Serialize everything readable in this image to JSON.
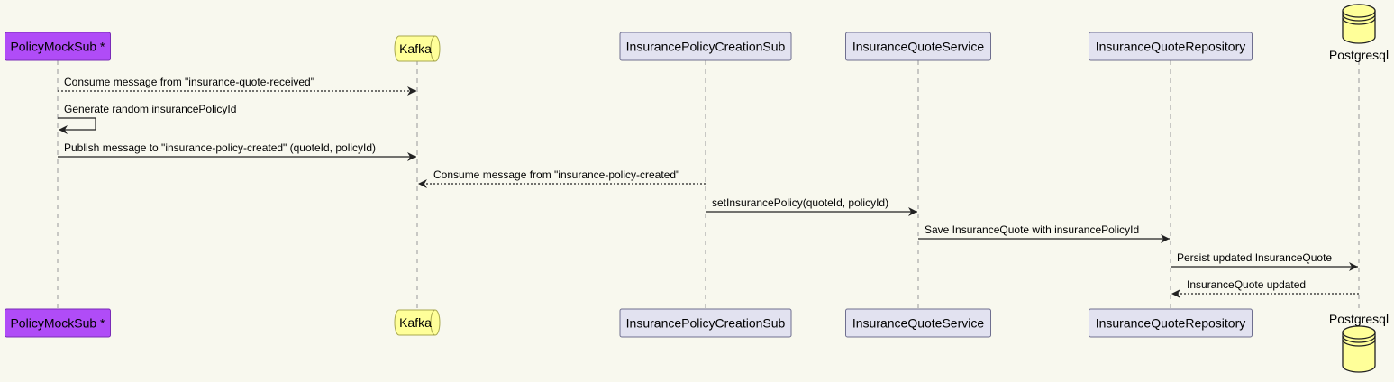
{
  "diagram": {
    "type": "sequence",
    "colors": {
      "background": "#f8f8ee",
      "highlight_fill": "#b04cf7",
      "highlight_stroke": "#7a2bb7",
      "queue_fill": "#ffff99",
      "queue_stroke": "#a8a84e",
      "participant_fill": "#e2e2f0",
      "participant_stroke": "#6f6f8f",
      "db_fill": "#ffff99",
      "db_stroke": "#222222",
      "lifeline": "#999999",
      "arrow": "#222222"
    },
    "participants": [
      {
        "id": "policymocksub",
        "label": "PolicyMockSub *",
        "shape": "rect",
        "style": "highlight"
      },
      {
        "id": "kafka",
        "label": "Kafka",
        "shape": "queue",
        "style": "queue"
      },
      {
        "id": "creationsub",
        "label": "InsurancePolicyCreationSub",
        "shape": "rect",
        "style": "participant"
      },
      {
        "id": "quoteservice",
        "label": "InsuranceQuoteService",
        "shape": "rect",
        "style": "participant"
      },
      {
        "id": "quoterepository",
        "label": "InsuranceQuoteRepository",
        "shape": "rect",
        "style": "participant"
      },
      {
        "id": "postgresql",
        "label": "Postgresql",
        "shape": "database",
        "style": "db"
      }
    ],
    "messages": [
      {
        "from": "policymocksub",
        "to": "kafka",
        "label": "Consume message from \"insurance-quote-received\"",
        "style": "dashed"
      },
      {
        "from": "policymocksub",
        "to": "policymocksub",
        "label": "Generate random insurancePolicyId",
        "style": "solid"
      },
      {
        "from": "policymocksub",
        "to": "kafka",
        "label": "Publish message to \"insurance-policy-created\" (quoteId, policyId)",
        "style": "solid"
      },
      {
        "from": "creationsub",
        "to": "kafka",
        "label": "Consume message from \"insurance-policy-created\"",
        "style": "dashed"
      },
      {
        "from": "creationsub",
        "to": "quoteservice",
        "label": "setInsurancePolicy(quoteId, policyId)",
        "style": "solid"
      },
      {
        "from": "quoteservice",
        "to": "quoterepository",
        "label": "Save InsuranceQuote with insurancePolicyId",
        "style": "solid"
      },
      {
        "from": "quoterepository",
        "to": "postgresql",
        "label": "Persist updated InsuranceQuote",
        "style": "solid"
      },
      {
        "from": "postgresql",
        "to": "quoterepository",
        "label": "InsuranceQuote updated",
        "style": "dashed"
      }
    ]
  }
}
